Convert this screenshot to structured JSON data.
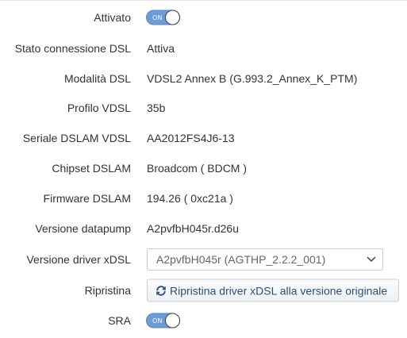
{
  "fields": {
    "attivato": {
      "label": "Attivato",
      "toggle_text": "ON"
    },
    "stato_connessione": {
      "label": "Stato connessione DSL",
      "value": "Attiva"
    },
    "modalita": {
      "label": "Modalità DSL",
      "value": "VDSL2 Annex B (G.993.2_Annex_K_PTM)"
    },
    "profilo": {
      "label": "Profilo VDSL",
      "value": "35b"
    },
    "seriale": {
      "label": "Seriale DSLAM VDSL",
      "value": "AA2012FS4J6-13"
    },
    "chipset": {
      "label": "Chipset DSLAM",
      "value": "Broadcom ( BDCM )"
    },
    "firmware": {
      "label": "Firmware DSLAM",
      "value": "194.26 ( 0xc21a )"
    },
    "datapump": {
      "label": "Versione datapump",
      "value": "A2pvfbH045r.d26u"
    },
    "driver": {
      "label": "Versione driver xDSL",
      "selected": "A2pvfbH045r (AGTHP_2.2.2_001)"
    },
    "ripristina": {
      "label": "Ripristina",
      "button_label": "Ripristina driver xDSL alla versione originale"
    },
    "sra": {
      "label": "SRA",
      "toggle_text": "ON"
    }
  },
  "icons": {
    "select_arrow": "chevron-down-icon",
    "button_icon": "refresh-icon"
  },
  "colors": {
    "toggle_on": "#6f9bd4",
    "button_text": "#2a4f7a",
    "label_text": "#333333"
  }
}
